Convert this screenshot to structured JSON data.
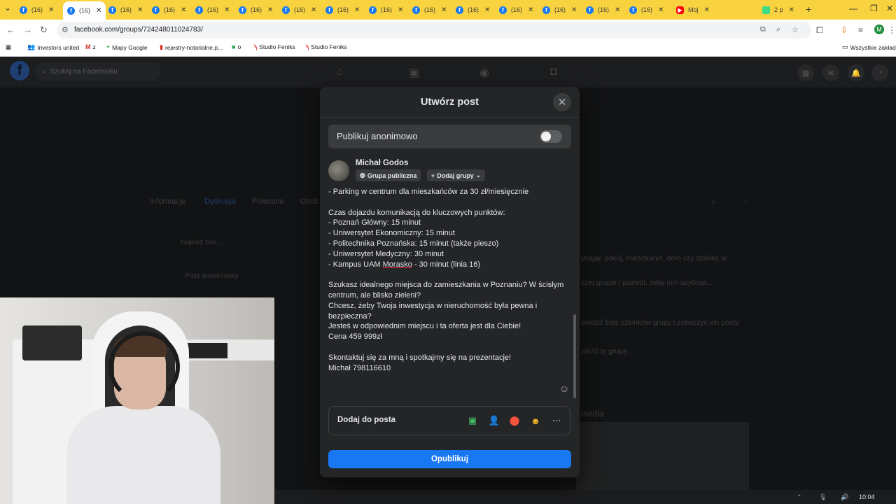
{
  "browser": {
    "tabs": [
      {
        "label": "(16)"
      },
      {
        "label": "(16)"
      },
      {
        "label": "(16)"
      },
      {
        "label": "(16)"
      },
      {
        "label": "(16)"
      },
      {
        "label": "(16)"
      },
      {
        "label": "(16)"
      },
      {
        "label": "(16)"
      },
      {
        "label": "(16)"
      },
      {
        "label": "(16)"
      },
      {
        "label": "(16)"
      },
      {
        "label": "(16)"
      },
      {
        "label": "(16)"
      },
      {
        "label": "(16)"
      },
      {
        "label": "(16)"
      },
      {
        "label": "Moj"
      },
      {
        "label": "2 p"
      }
    ],
    "url": "facebook.com/groups/724248011024783/",
    "profile_initial": "M",
    "bookmarks": [
      {
        "label": "Investors united"
      },
      {
        "label": "z"
      },
      {
        "label": "Mapy Google"
      },
      {
        "label": "rejestry-notarialne.p..."
      },
      {
        "label": "o"
      },
      {
        "label": "Studio Feniks"
      },
      {
        "label": "Studio Feniks"
      }
    ],
    "all_bookmarks": "Wszystkie zakład"
  },
  "facebook": {
    "search_placeholder": "Szukaj na Facebooku",
    "group_tabs": [
      "Informacje",
      "Dyskusja",
      "Polecane",
      "Osob"
    ],
    "composer_placeholder": "Napisz coś...",
    "anon_post": "Post anonimowy",
    "bg_right_lines": [
      "ynając pokój, mieszkanie, dom czy działkę w",
      "szej grupie i pozwól, żeby inni użytkow...",
      "awdzić listę członków grupy i zobaczyć ich posty.",
      "aleźć tę grupę.",
      "media"
    ]
  },
  "modal": {
    "title": "Utwórz post",
    "anonymous_label": "Publikuj anonimowo",
    "anonymous_on": false,
    "author": "Michał Godos",
    "audience": "Grupa publiczna",
    "add_groups": "Dodaj grupy",
    "post_lines": [
      "- Parking w centrum dla mieszkańców za 30 zł/miesięcznie",
      "",
      "Czas dojazdu komunikacją do kluczowych punktów:",
      "- Poznań Główny: 15 minut",
      "- Uniwersytet Ekonomiczny: 15 minut",
      "- Politechnika Poznańska: 15 minut (także pieszo)",
      "- Uniwersytet Medyczny: 30 minut",
      "- Kampus UAM Morasko - 30 minut (linia 16)",
      "",
      "Szukasz idealnego miejsca do zamieszkania w Poznaniu? W ścisłym",
      "centrum, ale blisko zieleni?",
      "Chcesz, żeby Twoja inwestycja w nieruchomość była pewna i",
      "bezpieczna?",
      "Jesteś w odpowiednim miejscu i ta oferta jest dla Ciebie!",
      "Cena 459 999zł",
      "",
      "Skontaktuj się za mną i spotkajmy się na prezentacje!",
      "Michał 798116610"
    ],
    "add_to_post": "Dodaj do posta",
    "publish": "Opublikuj"
  },
  "taskbar": {
    "time": "10:04"
  },
  "colors": {
    "accent": "#1877f2",
    "tabbar": "#f8d33f",
    "modal_bg": "#242526"
  }
}
